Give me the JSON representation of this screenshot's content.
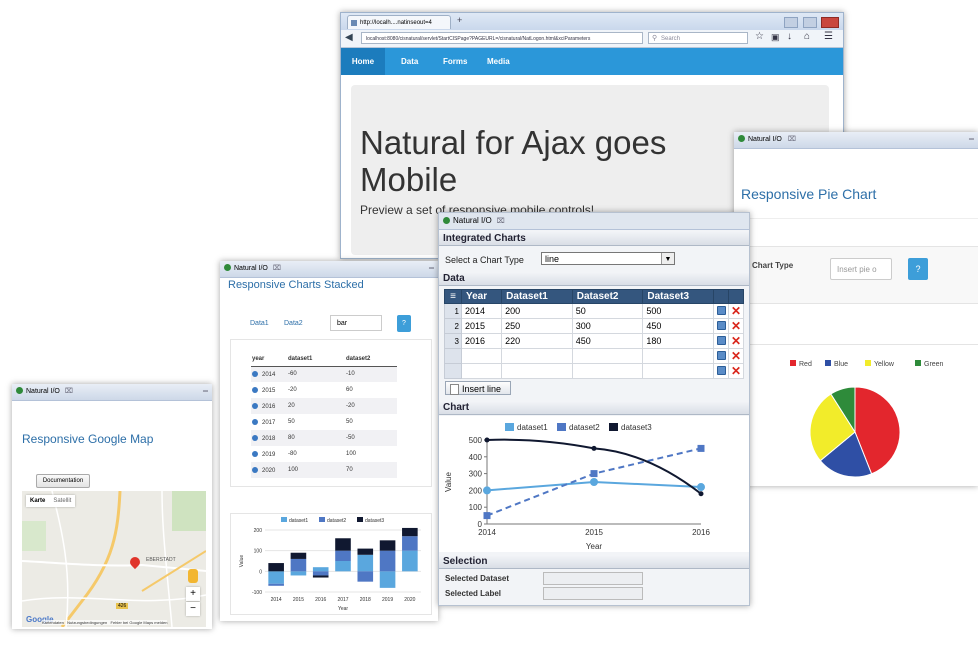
{
  "browser": {
    "tab_title": "http://localh....natinseout=4",
    "new_tab": "+",
    "url": "localhost:8080/cisnatural/servlet/StartCISPage?PAGEURL=/cisnatural/NatLogon.html&xciParameters",
    "search_placeholder": "Search",
    "nav": [
      "Home",
      "Data",
      "Forms",
      "Media"
    ]
  },
  "hero": {
    "title_line1": "Natural for Ajax goes",
    "title_line2": "Mobile",
    "subtitle": "Preview a set of responsive mobile controls!"
  },
  "pie_window": {
    "tab": "Natural I/O",
    "title": "Responsive Pie Chart",
    "chart_type_label": "Chart Type",
    "chart_type_placeholder": "Insert pie o",
    "help": "?",
    "legend": [
      "Red",
      "Blue",
      "Yellow",
      "Green"
    ],
    "colors": [
      "#e3262d",
      "#2f4fa5",
      "#f2ec2a",
      "#2e8b3a"
    ]
  },
  "integrated": {
    "tab": "Natural I/O",
    "title": "Integrated Charts",
    "select_label": "Select a Chart Type",
    "select_value": "line",
    "data_section": "Data",
    "columns": [
      "Year",
      "Dataset1",
      "Dataset2",
      "Dataset3"
    ],
    "rows": [
      {
        "n": "1",
        "year": "2014",
        "d1": "200",
        "d2": "50",
        "d3": "500"
      },
      {
        "n": "2",
        "year": "2015",
        "d1": "250",
        "d2": "300",
        "d3": "450"
      },
      {
        "n": "3",
        "year": "2016",
        "d1": "220",
        "d2": "450",
        "d3": "180"
      }
    ],
    "insert_line": "Insert line",
    "chart_section": "Chart",
    "selection_section": "Selection",
    "selected_dataset_label": "Selected Dataset",
    "selected_label_label": "Selected Label"
  },
  "stacked": {
    "tab": "Natural I/O",
    "title": "Responsive Charts Stacked",
    "link1": "Data1",
    "link2": "Data2",
    "type_value": "bar",
    "help": "?",
    "columns": [
      "year",
      "dataset1",
      "dataset2"
    ],
    "rows": [
      [
        "2014",
        "-60",
        "-10"
      ],
      [
        "2015",
        "-20",
        "60"
      ],
      [
        "2016",
        "20",
        "-20"
      ],
      [
        "2017",
        "50",
        "50"
      ],
      [
        "2018",
        "80",
        "-50"
      ],
      [
        "2019",
        "-80",
        "100"
      ],
      [
        "2020",
        "100",
        "70"
      ]
    ]
  },
  "gmap": {
    "tab": "Natural I/O",
    "title": "Responsive Google Map",
    "doc_button": "Documentation",
    "map_tab1": "Karte",
    "map_tab2": "Satellit",
    "place": "EBERSTADT",
    "road": "426",
    "zoom_in": "+",
    "zoom_out": "−",
    "google": "Google",
    "footer": "Kartendaten   Nutzungsbedingungen   Fehler bei Google Maps melden"
  },
  "chart_data": [
    {
      "type": "line",
      "x": [
        2014,
        2015,
        2016
      ],
      "series": [
        {
          "name": "dataset1",
          "values": [
            200,
            250,
            220
          ],
          "color": "#5aa7de"
        },
        {
          "name": "dataset2",
          "values": [
            50,
            300,
            450
          ],
          "color": "#4f77c4"
        },
        {
          "name": "dataset3",
          "values": [
            500,
            450,
            180
          ],
          "color": "#101830"
        }
      ],
      "xlabel": "Year",
      "ylabel": "Value",
      "ylim": [
        0,
        500
      ],
      "yticks": [
        0,
        100,
        200,
        300,
        400,
        500
      ],
      "legend": "top"
    },
    {
      "type": "bar",
      "categories": [
        "2014",
        "2015",
        "2016",
        "2017",
        "2018",
        "2019",
        "2020"
      ],
      "series": [
        {
          "name": "dataset1",
          "values": [
            -60,
            -20,
            20,
            50,
            80,
            -80,
            100
          ],
          "color": "#5aa7de"
        },
        {
          "name": "dataset2",
          "values": [
            -10,
            60,
            -20,
            50,
            -50,
            100,
            70
          ],
          "color": "#4f77c4"
        },
        {
          "name": "dataset3",
          "values": [
            40,
            30,
            -10,
            60,
            30,
            50,
            40
          ],
          "color": "#101830"
        }
      ],
      "xlabel": "Year",
      "ylabel": "Value",
      "ylim": [
        -100,
        200
      ],
      "yticks": [
        -100,
        0,
        100,
        200
      ],
      "legend": "top"
    },
    {
      "type": "pie",
      "labels": [
        "Red",
        "Blue",
        "Yellow",
        "Green"
      ],
      "values": [
        44,
        20,
        27,
        9
      ],
      "colors": [
        "#e3262d",
        "#2f4fa5",
        "#f2ec2a",
        "#2e8b3a"
      ]
    }
  ]
}
